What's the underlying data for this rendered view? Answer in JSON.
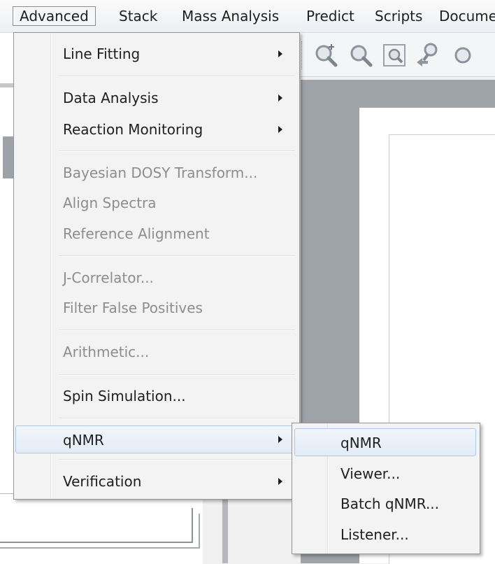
{
  "menubar": {
    "items": [
      "Advanced",
      "Stack",
      "Mass Analysis",
      "Predict",
      "Scripts",
      "Documents"
    ]
  },
  "toolbar": {
    "icons": [
      "zoom-in-icon",
      "zoom-out-icon",
      "zoom-fit-icon",
      "pointer-icon"
    ]
  },
  "menu": {
    "line_fitting": "Line Fitting",
    "data_analysis": "Data Analysis",
    "reaction_monitoring": "Reaction Monitoring",
    "bayesian_dosy": "Bayesian DOSY Transform...",
    "align_spectra": "Align Spectra",
    "reference_alignment": "Reference Alignment",
    "j_correlator": "J-Correlator...",
    "filter_false_positives": "Filter False Positives",
    "arithmetic": "Arithmetic...",
    "spin_simulation": "Spin Simulation...",
    "qnmr": "qNMR",
    "verification": "Verification"
  },
  "submenu": {
    "qnmr": "qNMR",
    "viewer": "Viewer...",
    "batch_qnmr": "Batch qNMR...",
    "listener": "Listener..."
  },
  "colors": {
    "menu_background": "#f3f3f3",
    "hover_border": "#aec7e3",
    "disabled_text": "#8d8d8d",
    "workspace": "#9ea3a8"
  }
}
